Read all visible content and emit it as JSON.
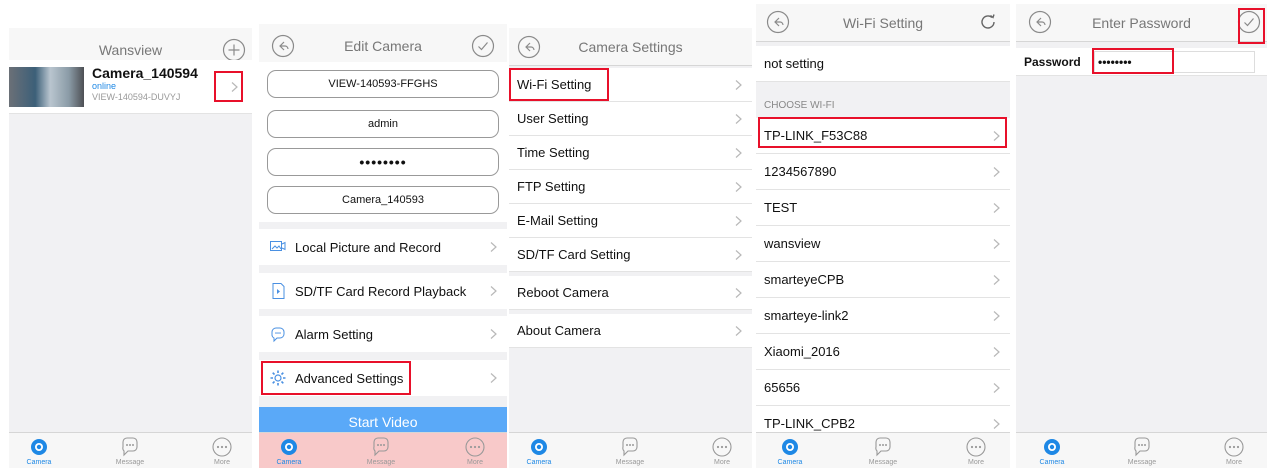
{
  "icons": {
    "back": "back-icon",
    "add": "add-icon",
    "confirm": "checkmark-icon",
    "refresh": "refresh-icon",
    "chevron": "chevron-right-icon",
    "camera_tab": "eye-icon",
    "message_tab": "message-bubble-icon",
    "more_tab": "more-icon"
  },
  "colors": {
    "accent": "#1e88e5",
    "highlight": "#e8102a",
    "start_button": "#5aa9f8"
  },
  "tabs": [
    {
      "label": "Camera"
    },
    {
      "label": "Message"
    },
    {
      "label": "More"
    }
  ],
  "screen1": {
    "title": "Wansview",
    "camera": {
      "name": "Camera_140594",
      "status": "online",
      "id": "VIEW-140594-DUVYJ"
    }
  },
  "screen2": {
    "title": "Edit Camera",
    "uid": "VIEW-140593-FFGHS",
    "username": "admin",
    "password": "••••••••",
    "camera_name": "Camera_140593",
    "menu": [
      {
        "label": "Local Picture and Record",
        "icon": "picture-icon"
      },
      {
        "label": "SD/TF Card Record Playback",
        "icon": "sd-card-icon"
      },
      {
        "label": "Alarm Setting",
        "icon": "alarm-icon"
      },
      {
        "label": "Advanced Settings",
        "icon": "gear-icon"
      }
    ],
    "start_video": "Start Video"
  },
  "screen3": {
    "title": "Camera Settings",
    "items": [
      "Wi-Fi Setting",
      "User Setting",
      "Time Setting",
      "FTP Setting",
      "E-Mail Setting",
      "SD/TF Card Setting",
      "Reboot Camera",
      "About Camera"
    ]
  },
  "screen4": {
    "title": "Wi-Fi Setting",
    "current": "not setting",
    "section": "CHOOSE WI-FI",
    "networks": [
      "TP-LINK_F53C88",
      "1234567890",
      "TEST",
      "wansview",
      "smarteyeCPB",
      "smarteye-link2",
      "Xiaomi_2016",
      "65656",
      "TP-LINK_CPB2"
    ]
  },
  "screen5": {
    "title": "Enter Password",
    "label": "Password",
    "value": "••••••••"
  }
}
